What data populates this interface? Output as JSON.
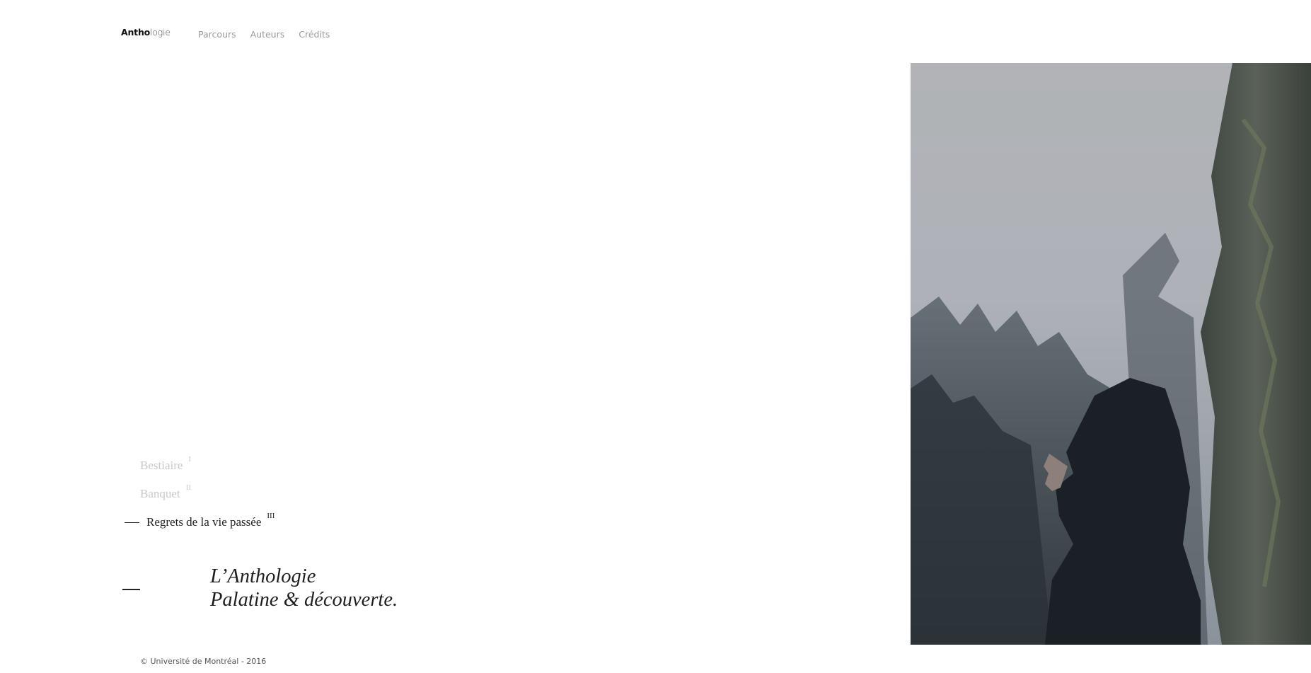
{
  "header": {
    "logo_strong": "Antho",
    "logo_light": "logie",
    "nav": [
      "Parcours",
      "Auteurs",
      "Crédits"
    ]
  },
  "parcours": [
    {
      "label": "Bestiaire",
      "numeral": "I",
      "active": false
    },
    {
      "label": "Banquet",
      "numeral": "II",
      "active": false
    },
    {
      "label": "Regrets de la vie passée",
      "numeral": "III",
      "active": true
    }
  ],
  "intro": {
    "line1": "L’Anthologie",
    "line2": "Palatine & découverte."
  },
  "footer": {
    "copyright": "© Université de Montréal - 2016"
  },
  "colors": {
    "text": "#222222",
    "muted": "#9a9a9a",
    "inactive": "#c9c9c9"
  }
}
